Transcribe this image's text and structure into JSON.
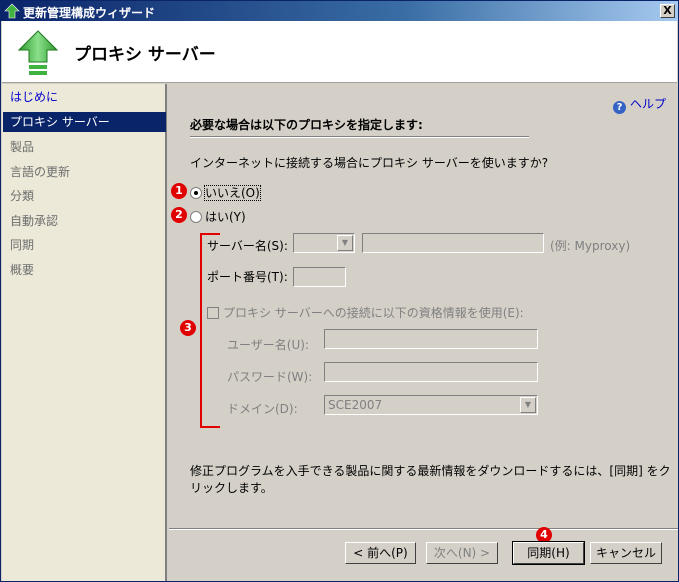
{
  "window": {
    "title": "更新管理構成ウィザード",
    "close_label": "X"
  },
  "banner": {
    "title": "プロキシ サーバー"
  },
  "sidebar": {
    "items": [
      {
        "label": "はじめに",
        "state": "link"
      },
      {
        "label": "プロキシ サーバー",
        "state": "active"
      },
      {
        "label": "製品",
        "state": "disabled"
      },
      {
        "label": "言語の更新",
        "state": "disabled"
      },
      {
        "label": "分類",
        "state": "disabled"
      },
      {
        "label": "自動承認",
        "state": "disabled"
      },
      {
        "label": "同期",
        "state": "disabled"
      },
      {
        "label": "概要",
        "state": "disabled"
      }
    ]
  },
  "main": {
    "help_label": "ヘルプ",
    "help_icon": "help-icon",
    "heading": "必要な場合は以下のプロキシを指定します:",
    "question": "インターネットに接続する場合にプロキシ サーバーを使いますか?",
    "radio_no": {
      "label": "いいえ(O)",
      "checked": true
    },
    "radio_yes": {
      "label": "はい(Y)",
      "checked": false
    },
    "server_name_label": "サーバー名(S):",
    "server_example": "(例: Myproxy)",
    "port_label": "ポート番号(T):",
    "credentials_checkbox_label": "プロキシ サーバーへの接続に以下の資格情報を使用(E):",
    "username_label": "ユーザー名(U):",
    "password_label": "パスワード(W):",
    "domain_label": "ドメイン(D):",
    "domain_value": "SCE2007",
    "footer_text": "修正プログラムを入手できる製品に関する最新情報をダウンロードするには、[同期] をクリックします。"
  },
  "markers": [
    "1",
    "2",
    "3",
    "4"
  ],
  "buttons": {
    "back": "< 前へ(P)",
    "next": "次へ(N) >",
    "sync": "同期(H)",
    "cancel": "キャンセル"
  },
  "colors": {
    "marker": "#e00000",
    "titlebar": "#0a246a",
    "link": "#0000cc"
  }
}
